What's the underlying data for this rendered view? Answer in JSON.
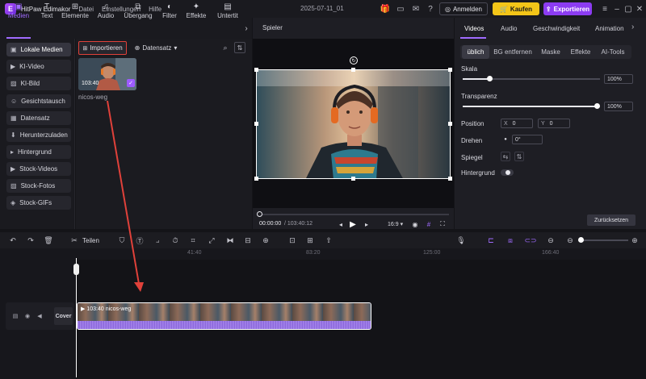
{
  "titlebar": {
    "app_name": "HitPaw Edimakor",
    "menus": [
      "Datei",
      "Einstellungen",
      "Hilfe"
    ],
    "project_date": "2025-07-11_01",
    "login_label": "Anmelden",
    "buy_label": "Kaufen",
    "export_label": "Exportieren"
  },
  "toolbar": {
    "tabs": [
      {
        "label": "Medien",
        "icon": "folder-icon"
      },
      {
        "label": "Text",
        "icon": "text-icon"
      },
      {
        "label": "Elemente",
        "icon": "elements-icon"
      },
      {
        "label": "Audio",
        "icon": "music-icon"
      },
      {
        "label": "Übergang",
        "icon": "transition-icon"
      },
      {
        "label": "Filter",
        "icon": "filter-icon"
      },
      {
        "label": "Effekte",
        "icon": "effects-icon"
      },
      {
        "label": "Untertit",
        "icon": "subtitle-icon"
      }
    ]
  },
  "sidebar": {
    "items": [
      {
        "label": "Lokale Medien",
        "active": true
      },
      {
        "label": "KI-Video"
      },
      {
        "label": "KI-Bild"
      },
      {
        "label": "Gesichtstausch"
      },
      {
        "label": "Datensatz"
      },
      {
        "label": "Herunterzuladen"
      },
      {
        "label": "Hintergrund"
      },
      {
        "label": "Stock-Videos"
      },
      {
        "label": "Stock-Fotos"
      },
      {
        "label": "Stock-GIFs"
      }
    ]
  },
  "media": {
    "import_label": "Importieren",
    "dataset_label": "Datensatz",
    "thumbnail": {
      "duration": "103:40",
      "name": "nicos-weg"
    }
  },
  "preview": {
    "title": "Spieler",
    "current_time": "00:00:00",
    "total_time": "/ 103:40:12",
    "ratio": "16:9"
  },
  "right_panel": {
    "tabs": [
      "Videos",
      "Audio",
      "Geschwindigkeit",
      "Animation"
    ],
    "subtabs": [
      "üblich",
      "BG entfernen",
      "Maske",
      "Effekte",
      "AI-Tools"
    ],
    "scale_label": "Skala",
    "scale_value": "100%",
    "scale_level": 1.0,
    "opacity_label": "Transparenz",
    "opacity_value": "100%",
    "opacity_level": 1.0,
    "position_label": "Position",
    "x_label": "X",
    "x_value": "0",
    "y_label": "Y",
    "y_value": "0",
    "rotate_label": "Drehen",
    "rotate_value": "0°",
    "mirror_label": "Spiegel",
    "background_label": "Hintergrund",
    "reset_label": "Zurücksetzen"
  },
  "timeline": {
    "split_label": "Teilen",
    "ruler_labels": [
      "41:40",
      "83:20",
      "125:00",
      "166:40"
    ],
    "cover_label": "Cover",
    "clip": {
      "duration": "103:40",
      "name": "nicos-weg"
    }
  },
  "colors": {
    "accent": "#a06bff",
    "buy": "#f3c518",
    "export": "#8c3cf2",
    "highlight": "#e0413a"
  }
}
